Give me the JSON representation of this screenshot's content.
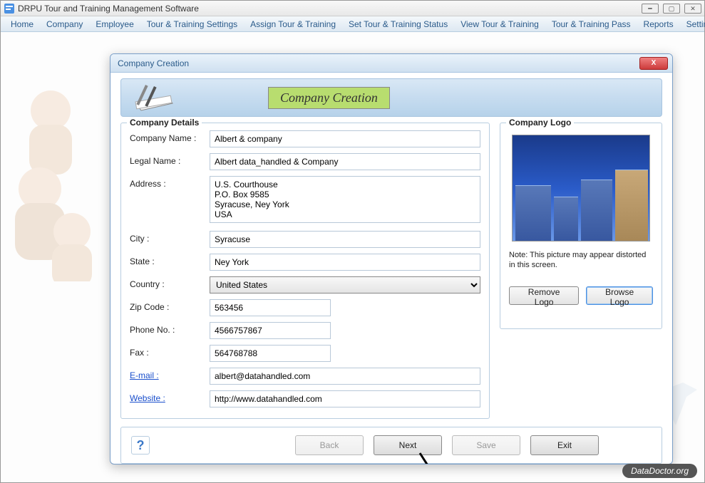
{
  "window": {
    "title": "DRPU Tour and Training Management Software"
  },
  "menu": [
    "Home",
    "Company",
    "Employee",
    "Tour & Training Settings",
    "Assign Tour & Training",
    "Set Tour & Training Status",
    "View Tour & Training",
    "Tour & Training Pass",
    "Reports",
    "Settings"
  ],
  "dialog": {
    "title": "Company Creation",
    "banner_title": "Company Creation",
    "details_legend": "Company Details",
    "logo_legend": "Company Logo",
    "labels": {
      "company_name": "Company Name :",
      "legal_name": "Legal Name :",
      "address": "Address :",
      "city": "City :",
      "state": "State :",
      "country": "Country :",
      "zip": "Zip Code :",
      "phone": "Phone No. :",
      "fax": "Fax :",
      "email": "E-mail :",
      "website": "Website :"
    },
    "values": {
      "company_name": "Albert & company",
      "legal_name": "Albert data_handled & Company",
      "address": "U.S. Courthouse\nP.O. Box 9585\nSyracuse, Ney York\nUSA",
      "city": "Syracuse",
      "state": "Ney York",
      "country": "United States",
      "zip": "563456",
      "phone": "4566757867",
      "fax": "564768788",
      "email": "albert@datahandled.com",
      "website": "http://www.datahandled.com"
    },
    "logo_note": "Note: This picture may appear distorted in this screen.",
    "buttons": {
      "remove_logo": "Remove Logo",
      "browse_logo": "Browse Logo",
      "back": "Back",
      "next": "Next",
      "save": "Save",
      "exit": "Exit"
    }
  },
  "watermark": "DataDoctor.org"
}
